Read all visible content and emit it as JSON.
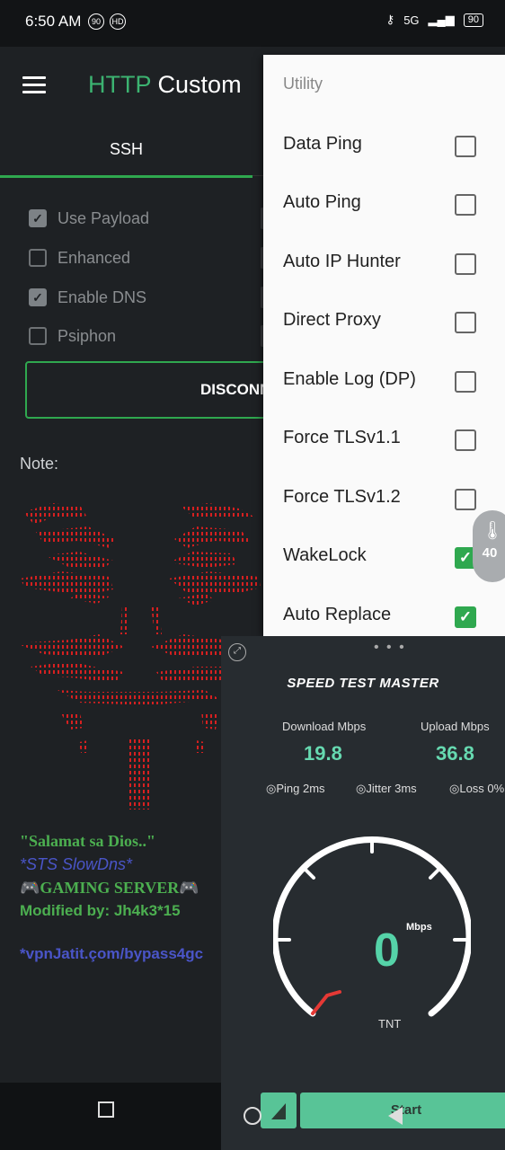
{
  "status_bar": {
    "time": "6:50 AM",
    "left_badges": [
      "90",
      "HD"
    ],
    "network": "5G",
    "battery": "90"
  },
  "app_bar": {
    "title_accent": "HTTP",
    "title_rest": "Custom"
  },
  "tabs": [
    {
      "label": "SSH"
    }
  ],
  "options": [
    {
      "label": "Use Payload",
      "checked": true
    },
    {
      "label": "Enhanced",
      "checked": false
    },
    {
      "label": "Enable DNS",
      "checked": true
    },
    {
      "label": "Psiphon",
      "checked": false
    }
  ],
  "connect_button": {
    "label": "DISCONNECT"
  },
  "note": {
    "label": "Note:",
    "lines": [
      "\"Salamat sa Dios..\"",
      "*STS SlowDns*",
      "🎮GAMING SERVER🎮",
      "Modified by: Jh4k3*15",
      "*vpnJatit.çom/bypass4gc"
    ]
  },
  "dropdown": {
    "header": "Utility",
    "items": [
      {
        "label": "Data Ping",
        "checked": false
      },
      {
        "label": "Auto Ping",
        "checked": false
      },
      {
        "label": "Auto IP Hunter",
        "checked": false
      },
      {
        "label": "Direct Proxy",
        "checked": false
      },
      {
        "label": "Enable Log (DP)",
        "checked": false
      },
      {
        "label": "Force TLSv1.1",
        "checked": false
      },
      {
        "label": "Force TLSv1.2",
        "checked": false
      },
      {
        "label": "WakeLock",
        "checked": true
      },
      {
        "label": "Auto Replace",
        "checked": true
      }
    ]
  },
  "temperature_badge": {
    "value": "40"
  },
  "speed_test": {
    "title": "SPEED TEST MASTER",
    "download_label": "Download Mbps",
    "download_value": "19.8",
    "upload_label": "Upload Mbps",
    "upload_value": "36.8",
    "ping": "Ping 2ms",
    "jitter": "Jitter 3ms",
    "loss": "Loss 0%",
    "gauge_value": "0",
    "gauge_unit": "Mbps",
    "isp": "TNT",
    "start_label": "Start",
    "accent": "#58c497"
  },
  "colors": {
    "brand_green": "#2fa84f",
    "background": "#1e2124",
    "mask_red": "#d62020"
  }
}
